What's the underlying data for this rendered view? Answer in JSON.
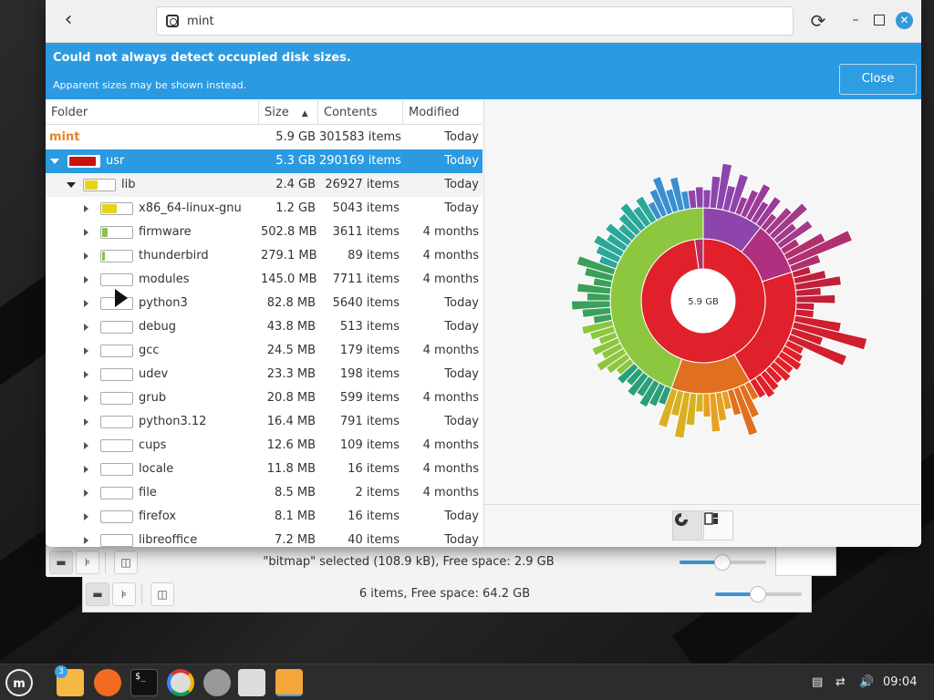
{
  "window": {
    "path_label": "mint",
    "back_icon": "chevron-left-icon",
    "refresh_icon": "refresh-icon"
  },
  "infobar": {
    "title": "Could not always detect occupied disk sizes.",
    "subtitle": "Apparent sizes may be shown instead.",
    "close_label": "Close"
  },
  "columns": {
    "folder": "Folder",
    "size": "Size",
    "contents": "Contents",
    "modified": "Modified"
  },
  "rows": [
    {
      "name": "mint",
      "size": "5.9 GB",
      "items": "301583 items",
      "modified": "Today",
      "fill": 1.0,
      "color": "#e8842c"
    },
    {
      "name": "usr",
      "size": "5.3 GB",
      "items": "290169 items",
      "modified": "Today",
      "fill": 0.9,
      "color": "#cc1010"
    },
    {
      "name": "lib",
      "size": "2.4 GB",
      "items": "26927 items",
      "modified": "Today",
      "fill": 0.45,
      "color": "#e6d21a"
    },
    {
      "name": "x86_64-linux-gnu",
      "size": "1.2 GB",
      "items": "5043 items",
      "modified": "Today",
      "fill": 0.5,
      "color": "#e6d21a"
    },
    {
      "name": "firmware",
      "size": "502.8 MB",
      "items": "3611 items",
      "modified": "4 months",
      "fill": 0.2,
      "color": "#8bc34a"
    },
    {
      "name": "thunderbird",
      "size": "279.1 MB",
      "items": "89 items",
      "modified": "4 months",
      "fill": 0.1,
      "color": "#8bc34a"
    },
    {
      "name": "modules",
      "size": "145.0 MB",
      "items": "7711 items",
      "modified": "4 months",
      "fill": 0.0,
      "color": "#8bc34a"
    },
    {
      "name": "python3",
      "size": "82.8 MB",
      "items": "5640 items",
      "modified": "Today",
      "fill": 0.0,
      "color": "#8bc34a"
    },
    {
      "name": "debug",
      "size": "43.8 MB",
      "items": "513 items",
      "modified": "Today",
      "fill": 0.0,
      "color": "#8bc34a"
    },
    {
      "name": "gcc",
      "size": "24.5 MB",
      "items": "179 items",
      "modified": "4 months",
      "fill": 0.0,
      "color": "#8bc34a"
    },
    {
      "name": "udev",
      "size": "23.3 MB",
      "items": "198 items",
      "modified": "Today",
      "fill": 0.0,
      "color": "#8bc34a"
    },
    {
      "name": "grub",
      "size": "20.8 MB",
      "items": "599 items",
      "modified": "4 months",
      "fill": 0.0,
      "color": "#8bc34a"
    },
    {
      "name": "python3.12",
      "size": "16.4 MB",
      "items": "791 items",
      "modified": "Today",
      "fill": 0.0,
      "color": "#8bc34a"
    },
    {
      "name": "cups",
      "size": "12.6 MB",
      "items": "109 items",
      "modified": "4 months",
      "fill": 0.0,
      "color": "#8bc34a"
    },
    {
      "name": "locale",
      "size": "11.8 MB",
      "items": "16 items",
      "modified": "4 months",
      "fill": 0.0,
      "color": "#8bc34a"
    },
    {
      "name": "file",
      "size": "8.5 MB",
      "items": "2 items",
      "modified": "4 months",
      "fill": 0.0,
      "color": "#8bc34a"
    },
    {
      "name": "firefox",
      "size": "8.1 MB",
      "items": "16 items",
      "modified": "Today",
      "fill": 0.0,
      "color": "#8bc34a"
    },
    {
      "name": "libreoffice",
      "size": "7.2 MB",
      "items": "40 items",
      "modified": "Today",
      "fill": 0.0,
      "color": "#8bc34a"
    }
  ],
  "chart": {
    "center_label": "5.9 GB"
  },
  "bg_window1": {
    "status": "\"bitmap\" selected (108.9 kB), Free space: 2.9 GB",
    "zoom": 0.5
  },
  "bg_window2": {
    "status": "6 items, Free space: 64.2 GB",
    "zoom": 0.5
  },
  "taskbar": {
    "badge": "3",
    "terminal_prompt": "$_",
    "clock": "09:04"
  }
}
